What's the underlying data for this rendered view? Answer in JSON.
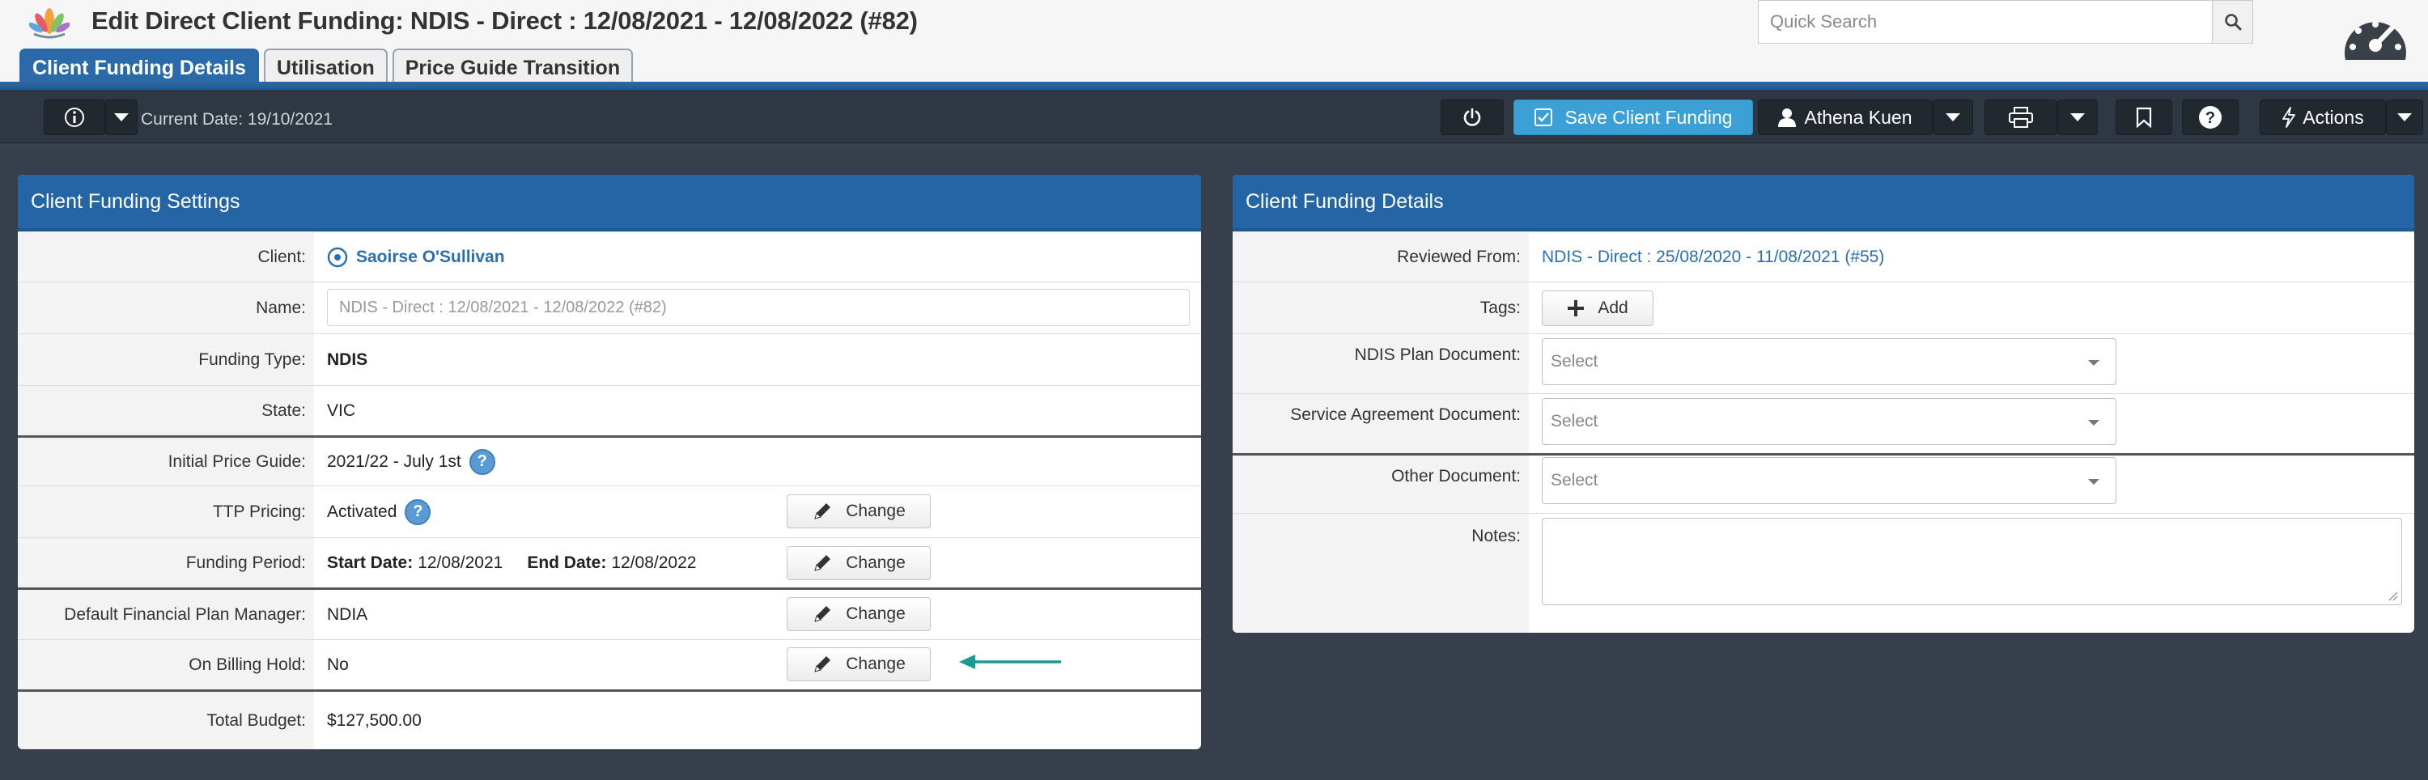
{
  "header": {
    "title": "Edit Direct Client Funding:  NDIS - Direct : 12/08/2021 - 12/08/2022 (#82)",
    "search_placeholder": "Quick Search"
  },
  "tabs": [
    {
      "label": "Client Funding Details",
      "active": true
    },
    {
      "label": "Utilisation",
      "active": false
    },
    {
      "label": "Price Guide Transition",
      "active": false
    }
  ],
  "toolbar": {
    "current_date": "Current Date: 19/10/2021",
    "save_label": "Save Client Funding",
    "user_name": "Athena Kuen",
    "actions_label": "Actions"
  },
  "settings": {
    "title": "Client Funding Settings",
    "client_label": "Client:",
    "client_value": "Saoirse O'Sullivan",
    "name_label": "Name:",
    "name_value": "NDIS - Direct : 12/08/2021 - 12/08/2022 (#82)",
    "funding_type_label": "Funding Type:",
    "funding_type_value": "NDIS",
    "state_label": "State:",
    "state_value": "VIC",
    "price_guide_label": "Initial Price Guide:",
    "price_guide_value": "2021/22 - July 1st",
    "ttp_label": "TTP Pricing:",
    "ttp_value": "Activated",
    "period_label": "Funding Period:",
    "start_label": "Start Date:",
    "start_value": "12/08/2021",
    "end_label": "End Date:",
    "end_value": "12/08/2022",
    "plan_manager_label": "Default Financial Plan Manager:",
    "plan_manager_value": "NDIA",
    "billing_hold_label": "On Billing Hold:",
    "billing_hold_value": "No",
    "budget_label": "Total Budget:",
    "budget_value": "$127,500.00",
    "change_label": "Change",
    "help_glyph": "?"
  },
  "details": {
    "title": "Client Funding Details",
    "reviewed_label": "Reviewed From:",
    "reviewed_value": "NDIS - Direct : 25/08/2020 - 11/08/2021 (#55)",
    "tags_label": "Tags:",
    "add_label": "Add",
    "plan_doc_label": "NDIS Plan Document:",
    "agreement_doc_label": "Service Agreement Document:",
    "other_doc_label": "Other Document:",
    "select_placeholder": "Select",
    "notes_label": "Notes:"
  },
  "colors": {
    "header_blue": "#2466a5",
    "save_button": "#3aa0d6",
    "link": "#2b6fb3",
    "arrow": "#1a9a95"
  }
}
